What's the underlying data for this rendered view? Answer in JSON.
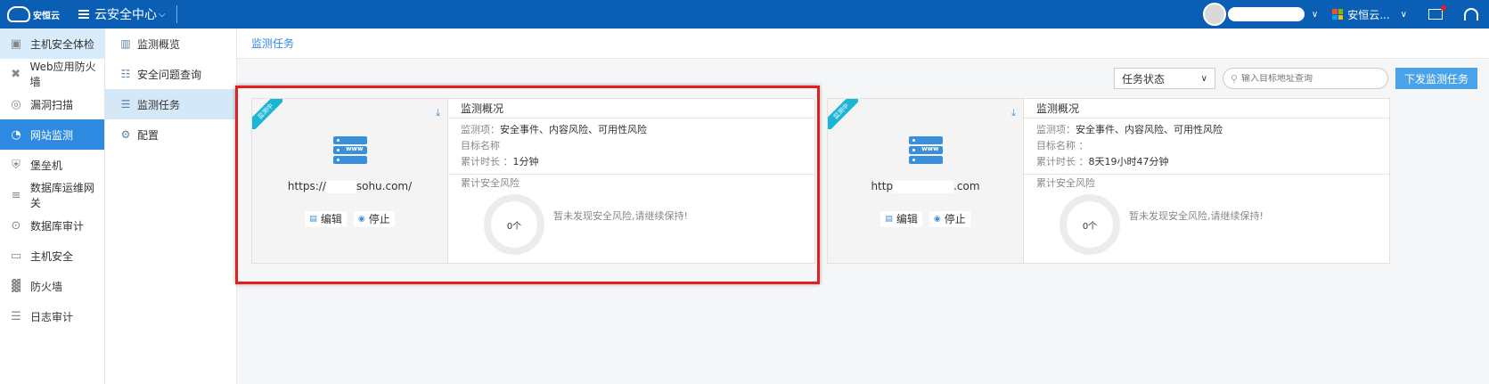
{
  "topbar": {
    "logo_text": "安恒云",
    "menu_label": "云安全中心",
    "org_name": "安恒云...",
    "colors": {
      "bar": "#0a5fb4",
      "accent": "#2d8ae0",
      "alert": "#e02020"
    }
  },
  "sidebar": {
    "items": [
      {
        "label": "主机安全体检",
        "icon": "host-check-icon"
      },
      {
        "label": "Web应用防火墙",
        "icon": "waf-icon"
      },
      {
        "label": "漏洞扫描",
        "icon": "scan-icon"
      },
      {
        "label": "网站监测",
        "icon": "monitor-icon"
      },
      {
        "label": "堡垒机",
        "icon": "bastion-icon"
      },
      {
        "label": "数据库运维网关",
        "icon": "database-icon"
      },
      {
        "label": "数据库审计",
        "icon": "db-audit-icon"
      },
      {
        "label": "主机安全",
        "icon": "host-icon"
      },
      {
        "label": "防火墙",
        "icon": "firewall-icon"
      },
      {
        "label": "日志审计",
        "icon": "log-icon"
      }
    ]
  },
  "subsidebar": {
    "items": [
      {
        "label": "监测概览"
      },
      {
        "label": "安全问题查询"
      },
      {
        "label": "监测任务"
      },
      {
        "label": "配置"
      }
    ]
  },
  "breadcrumb": "监测任务",
  "toolbar": {
    "status_select": "任务状态",
    "search_placeholder": "输入目标地址查询",
    "issue_button": "下发监测任务"
  },
  "cards": [
    {
      "ribbon": "监测中",
      "url_prefix": "https://",
      "url_suffix": "sohu.com/",
      "edit_label": "编辑",
      "stop_label": "停止",
      "overview_title": "监测概况",
      "items_key": "监测项：",
      "items_value": "安全事件、内容风险、可用性风险",
      "target_key": "目标名称",
      "target_value": "",
      "duration_key": "累计时长 ：",
      "duration_value": "1分钟",
      "risk_title": "累计安全风险",
      "risk_count": "0个",
      "risk_msg": "暂未发现安全风险,请继续保持!"
    },
    {
      "ribbon": "监测中",
      "url_prefix": "http",
      "url_suffix": ".com",
      "edit_label": "编辑",
      "stop_label": "停止",
      "overview_title": "监测概况",
      "items_key": "监测项：",
      "items_value": "安全事件、内容风险、可用性风险",
      "target_key": "目标名称 ：",
      "target_value": "",
      "duration_key": "累计时长 ：",
      "duration_value": "8天19小时47分钟",
      "risk_title": "累计安全风险",
      "risk_count": "0个",
      "risk_msg": "暂未发现安全风险,请继续保持!"
    }
  ]
}
